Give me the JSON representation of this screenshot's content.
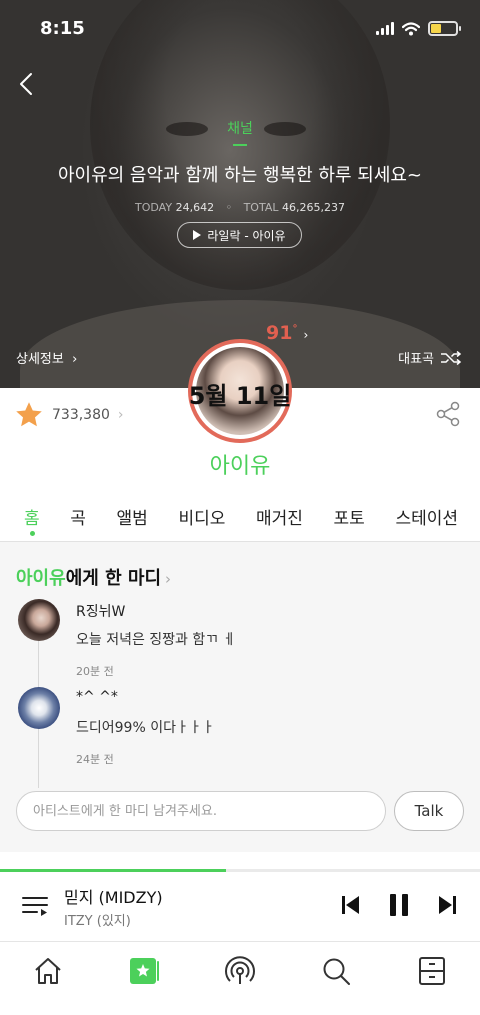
{
  "status_bar": {
    "time": "8:15"
  },
  "hero": {
    "channel_label": "채널",
    "headline": "아이유의 음악과 함께 하는 행복한 하루 되세요~",
    "stats": {
      "today_label": "TODAY",
      "today_value": "24,642",
      "total_label": "TOTAL",
      "total_value": "46,265,237"
    },
    "play_pill": "라일락 - 아이유",
    "detail_link": "상세정보",
    "top_songs_label": "대표곡",
    "temperature": "91",
    "temperature_unit": "°",
    "date_overlay": "5월 11일",
    "colors": {
      "accent": "#4cd05b",
      "temperature": "#e26050"
    }
  },
  "artist": {
    "likes": "733,380",
    "name": "아이유"
  },
  "tabs": [
    {
      "label": "홈",
      "active": true
    },
    {
      "label": "곡"
    },
    {
      "label": "앨범"
    },
    {
      "label": "비디오"
    },
    {
      "label": "매거진"
    },
    {
      "label": "포토"
    },
    {
      "label": "스테이션"
    }
  ],
  "comments_section": {
    "title_highlight": "아이유",
    "title_rest": "에게 한 마디",
    "items": [
      {
        "name": "R징뉘W",
        "text": "오늘 저녁은 징짱과 함ㄲ ㅔ",
        "time": "20분 전"
      },
      {
        "name": "*^ ^*",
        "text": "드디어99% 이다ㅏㅏㅏ",
        "time": "24분 전"
      }
    ],
    "input_placeholder": "아티스트에게 한 마디 남겨주세요.",
    "talk_label": "Talk"
  },
  "player": {
    "title": "믿지 (MIDZY)",
    "artist": "ITZY (있지)",
    "progress": 0.47
  },
  "nav": {
    "icons": [
      "home-icon",
      "artist-channel-icon",
      "station-icon",
      "search-icon",
      "storage-icon"
    ]
  }
}
